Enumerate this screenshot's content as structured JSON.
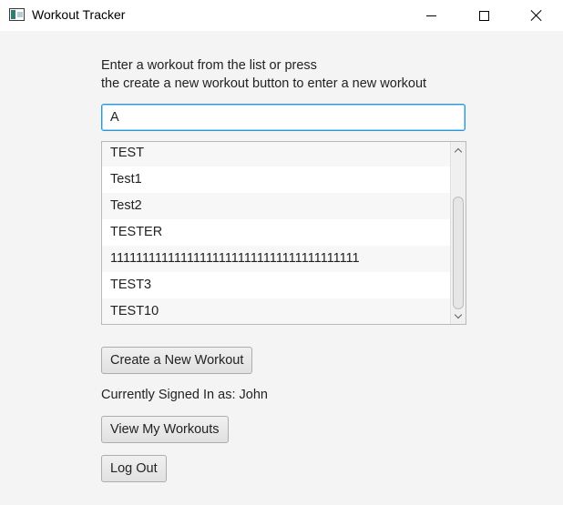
{
  "window": {
    "title": "Workout Tracker"
  },
  "instructions": {
    "line1": "Enter a workout from the list or press",
    "line2": "the create a new workout button to enter a new workout"
  },
  "search": {
    "value": "A"
  },
  "workouts": [
    "TEST",
    "Test1",
    "Test2",
    "TESTER",
    "111111111111111111111111111111111111111",
    "TEST3",
    "TEST10"
  ],
  "buttons": {
    "create_label": "Create a New Workout",
    "view_label": "View My Workouts",
    "logout_label": "Log Out"
  },
  "user": {
    "signed_in_text": "Currently Signed In as: John"
  },
  "icons": {
    "app": "app-window-icon",
    "minimize": "minimize-icon",
    "maximize": "maximize-icon",
    "close": "close-icon",
    "scroll_up": "chevron-up-icon",
    "scroll_down": "chevron-down-icon"
  },
  "colors": {
    "focus_border": "#2a96d4",
    "background": "#f4f4f4"
  }
}
